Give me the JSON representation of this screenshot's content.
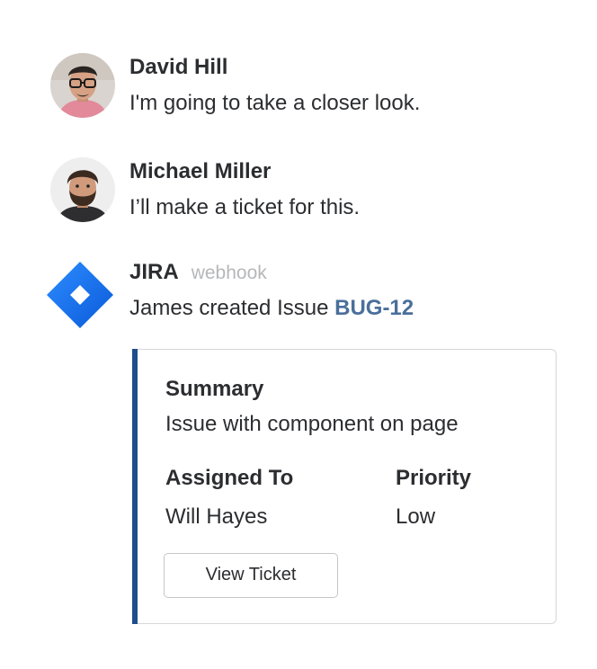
{
  "messages": [
    {
      "author": "David Hill",
      "text": "I'm going to take a closer look.",
      "avatar_icon": "person-glasses-avatar"
    },
    {
      "author": "Michael Miller",
      "text": "I’ll make a ticket for this.",
      "avatar_icon": "person-beard-avatar"
    },
    {
      "author": "JIRA",
      "tag": "webhook",
      "text_prefix": "James created Issue ",
      "issue_key": "BUG-12",
      "avatar_icon": "jira-logo-icon"
    }
  ],
  "card": {
    "summary_label": "Summary",
    "summary_value": "Issue with component on page",
    "assigned_label": "Assigned To",
    "assigned_value": "Will Hayes",
    "priority_label": "Priority",
    "priority_value": "Low",
    "button_label": "View Ticket"
  },
  "colors": {
    "accent_bar": "#1e4d8c",
    "link": "#4a6f9b",
    "jira_blue": "#2684ff",
    "muted": "#b6b7b9"
  }
}
